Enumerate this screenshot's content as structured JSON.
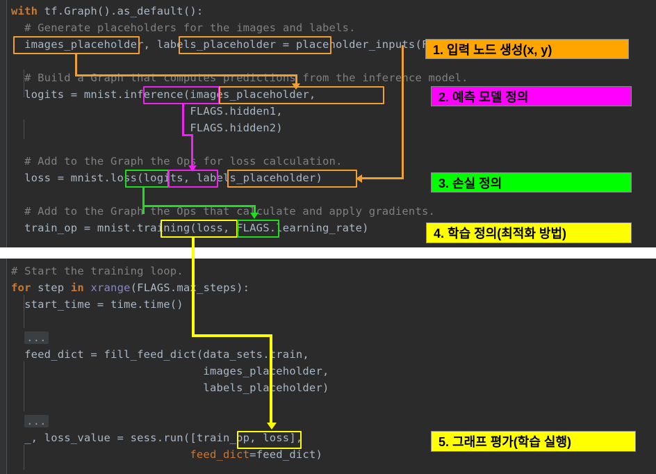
{
  "theme": {
    "editor_background": "#2b2b2b",
    "gutter_background": "#313335",
    "default_text": "#a9b7c6",
    "comment": "#808080",
    "keyword": "#cc7832",
    "builtin": "#8888c6",
    "page_background": "#ffffff"
  },
  "colors": {
    "orange": "#f0a030",
    "magenta": "#ef23ef",
    "green": "#1fdd1f",
    "yellow": "#ffff00"
  },
  "top_panel": {
    "lines": [
      "with tf.Graph().as_default():",
      "  # Generate placeholders for the images and labels.",
      "  images_placeholder, labels_placeholder = placeholder_inputs(FLAGS.batch_size)",
      "",
      "  # Build a Graph that computes predictions from the inference model.",
      "  logits = mnist.inference(images_placeholder,",
      "                           FLAGS.hidden1,",
      "                           FLAGS.hidden2)",
      "",
      "  # Add to the Graph the Ops for loss calculation.",
      "  loss = mnist.loss(logits, labels_placeholder)",
      "",
      "  # Add to the Graph the Ops that calculate and apply gradients.",
      "  train_op = mnist.training(loss, FLAGS.learning_rate)"
    ]
  },
  "bottom_panel": {
    "lines": [
      "# Start the training loop.",
      "for step in xrange(FLAGS.max_steps):",
      "  start_time = time.time()",
      "",
      "  ...",
      "  feed_dict = fill_feed_dict(data_sets.train,",
      "                             images_placeholder,",
      "                             labels_placeholder)",
      "",
      "  ...",
      "  _, loss_value = sess.run([train_op, loss],",
      "                           feed_dict=feed_dict)"
    ],
    "fold_marker": "..."
  },
  "tokens": {
    "images_placeholder_decl": "images_placeholder",
    "labels_placeholder_decl": "labels_placeholder",
    "inference": "inference",
    "images_placeholder_arg": "images_placeholder",
    "loss_fn": "loss",
    "logits_arg": "logits",
    "labels_placeholder_arg": "labels_placeholder",
    "training_fn": "training",
    "loss_arg": "loss",
    "train_op_arg": "train_op"
  },
  "callouts": [
    {
      "id": 1,
      "label": "1. 입력 노드 생성(x, y)",
      "color": "#ffa500"
    },
    {
      "id": 2,
      "label": "2. 예측 모델 정의",
      "color": "#ff00ff"
    },
    {
      "id": 3,
      "label": "3. 손실 정의",
      "color": "#00ff00"
    },
    {
      "id": 4,
      "label": "4. 학습 정의(최적화 방법)",
      "color": "#ffff00"
    },
    {
      "id": 5,
      "label": "5. 그래프 평가(학습 실행)",
      "color": "#ffff00"
    }
  ]
}
